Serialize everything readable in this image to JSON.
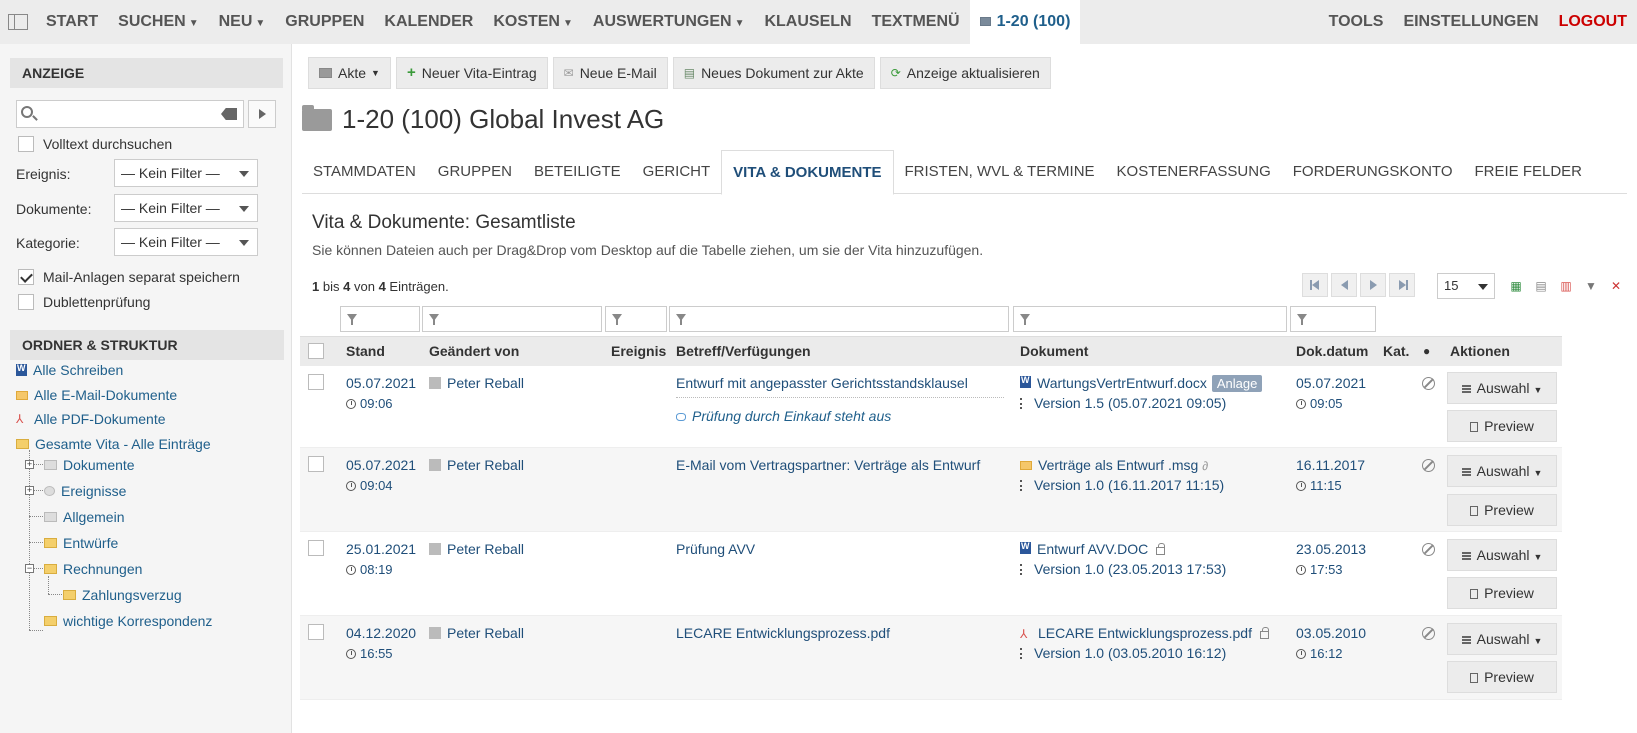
{
  "nav": {
    "left": [
      {
        "label": "START",
        "caret": false
      },
      {
        "label": "SUCHEN",
        "caret": true
      },
      {
        "label": "NEU",
        "caret": true
      },
      {
        "label": "GRUPPEN",
        "caret": false
      },
      {
        "label": "KALENDER",
        "caret": false
      },
      {
        "label": "KOSTEN",
        "caret": true
      },
      {
        "label": "AUSWERTUNGEN",
        "caret": true
      },
      {
        "label": "KLAUSELN",
        "caret": false
      },
      {
        "label": "TEXTMENÜ",
        "caret": false
      }
    ],
    "active_tab": "1-20 (100)",
    "tools": "TOOLS",
    "settings": "EINSTELLUNGEN",
    "logout": "LOGOUT"
  },
  "sidebar": {
    "anzeige_header": "ANZEIGE",
    "search_placeholder": "",
    "volltext": "Volltext durchsuchen",
    "ereignis_label": "Ereignis:",
    "dokumente_label": "Dokumente:",
    "kategorie_label": "Kategorie:",
    "filter_value": "— Kein Filter —",
    "mail_anlagen": "Mail-Anlagen separat speichern",
    "dubletten": "Dublettenprüfung",
    "ordner_header": "ORDNER & STRUKTUR",
    "tree": {
      "alle_schreiben": "Alle Schreiben",
      "alle_email": "Alle E-Mail-Dokumente",
      "alle_pdf": "Alle PDF-Dokumente",
      "gesamte_vita": "Gesamte Vita - Alle Einträge",
      "dokumente": "Dokumente",
      "ereignisse": "Ereignisse",
      "allgemein": "Allgemein",
      "entwuerfe": "Entwürfe",
      "rechnungen": "Rechnungen",
      "zahlungsverzug": "Zahlungsverzug",
      "wichtige": "wichtige Korrespondenz"
    }
  },
  "toolbar": {
    "akte": "Akte",
    "neuer_vita": "Neuer Vita-Eintrag",
    "neue_email": "Neue E-Mail",
    "neues_dokument": "Neues Dokument zur Akte",
    "aktualisieren": "Anzeige aktualisieren"
  },
  "page_title": "1-20 (100) Global Invest AG",
  "tabs": [
    "STAMMDATEN",
    "GRUPPEN",
    "BETEILIGTE",
    "GERICHT",
    "VITA & DOKUMENTE",
    "FRISTEN, WVL & TERMINE",
    "KOSTENERFASSUNG",
    "FORDERUNGSKONTO",
    "FREIE FELDER"
  ],
  "section": {
    "title": "Vita & Dokumente: Gesamtliste",
    "subtitle": "Sie können Dateien auch per Drag&Drop vom Desktop auf die Tabelle ziehen, um sie der Vita hinzuzufügen.",
    "count_from": "1",
    "count_bis": "bis",
    "count_to": "4",
    "count_von": "von",
    "count_total": "4",
    "count_suffix": "Einträgen."
  },
  "page_size": "15",
  "table": {
    "headers": {
      "stand": "Stand",
      "geaendert": "Geändert von",
      "ereignis": "Ereignis",
      "betreff": "Betreff/Verfügungen",
      "dokument": "Dokument",
      "dokdatum": "Dok.datum",
      "kat": "Kat.",
      "aktionen": "Aktionen"
    },
    "rows": [
      {
        "date": "05.07.2021",
        "time": "09:06",
        "user": "Peter Reball",
        "betreff": "Entwurf mit angepasster Gerichtsstandsklausel",
        "note": "Prüfung durch Einkauf steht aus",
        "doc": "WartungsVertrEntwurf.docx",
        "badge": "Anlage",
        "version": "Version 1.5 (05.07.2021 09:05)",
        "dokdate": "05.07.2021",
        "doktime": "09:05"
      },
      {
        "date": "05.07.2021",
        "time": "09:04",
        "user": "Peter Reball",
        "betreff": "E-Mail vom Vertragspartner: Verträge als Entwurf",
        "doc": "Verträge als Entwurf .msg",
        "version": "Version 1.0 (16.11.2017 11:15)",
        "dokdate": "16.11.2017",
        "doktime": "11:15"
      },
      {
        "date": "25.01.2021",
        "time": "08:19",
        "user": "Peter Reball",
        "betreff": "Prüfung AVV",
        "doc": "Entwurf AVV.DOC",
        "version": "Version 1.0 (23.05.2013 17:53)",
        "dokdate": "23.05.2013",
        "doktime": "17:53"
      },
      {
        "date": "04.12.2020",
        "time": "16:55",
        "user": "Peter Reball",
        "betreff": "LECARE Entwicklungsprozess.pdf",
        "doc": "LECARE Entwicklungsprozess.pdf",
        "version": "Version 1.0 (03.05.2010 16:12)",
        "dokdate": "03.05.2010",
        "doktime": "16:12"
      }
    ],
    "auswahl": "Auswahl",
    "preview": "Preview"
  },
  "colors": {
    "link": "#1f4e79",
    "logout": "#cc0000",
    "nav_active": "#1f5f8b"
  }
}
